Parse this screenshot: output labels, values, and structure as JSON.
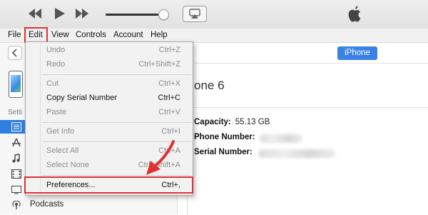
{
  "menubar": {
    "items": [
      {
        "label": "File"
      },
      {
        "label": "Edit"
      },
      {
        "label": "View"
      },
      {
        "label": "Controls"
      },
      {
        "label": "Account"
      },
      {
        "label": "Help"
      }
    ]
  },
  "toolbar": {
    "volume_level": 0.92
  },
  "sidebar": {
    "settings_label": "Setti",
    "podcasts_label": "Podcasts"
  },
  "main": {
    "device_button": "iPhone",
    "device_title": "one 6",
    "capacity_label": "Capacity:",
    "capacity_value": "55.13 GB",
    "phone_label": "Phone Number:",
    "serial_label": "Serial Number:"
  },
  "edit_menu": {
    "items": [
      {
        "label": "Undo",
        "shortcut": "Ctrl+Z",
        "enabled": false
      },
      {
        "label": "Redo",
        "shortcut": "Ctrl+Shift+Z",
        "enabled": false
      },
      {
        "label": "Cut",
        "shortcut": "Ctrl+X",
        "enabled": false
      },
      {
        "label": "Copy Serial Number",
        "shortcut": "Ctrl+C",
        "enabled": true
      },
      {
        "label": "Paste",
        "shortcut": "Ctrl+V",
        "enabled": false
      },
      {
        "label": "Get Info",
        "shortcut": "Ctrl+I",
        "enabled": false
      },
      {
        "label": "Select All",
        "shortcut": "Ctrl+A",
        "enabled": false
      },
      {
        "label": "Select None",
        "shortcut": "Ctrl+Shift+A",
        "enabled": false
      },
      {
        "label": "Preferences...",
        "shortcut": "Ctrl+,",
        "enabled": true
      }
    ]
  },
  "colors": {
    "highlight": "#e03131",
    "accent": "#3a82e4"
  }
}
